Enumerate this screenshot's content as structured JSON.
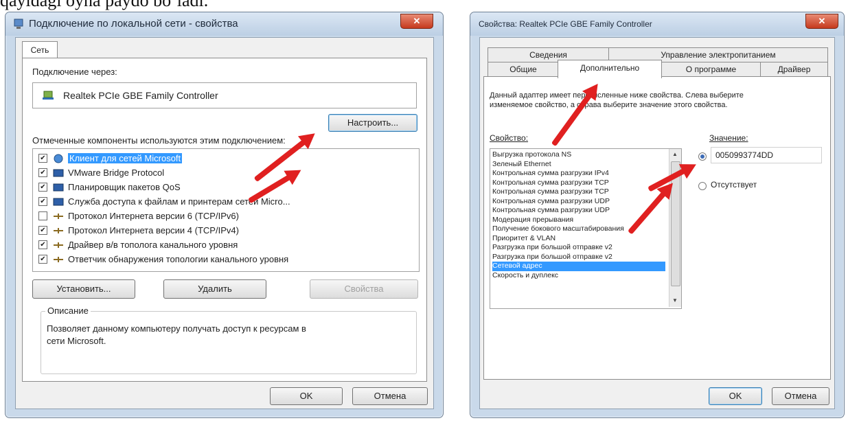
{
  "caption": "qayidagi oyna paydo bo`ladi.",
  "left_dialog": {
    "title": "Подключение по локальной сети - свойства",
    "tab": "Сеть",
    "connect_via_label": "Подключение через:",
    "adapter_name": "Realtek PCIe GBE Family Controller",
    "configure_button": "Настроить...",
    "components_label": "Отмеченные компоненты используются этим подключением:",
    "components": [
      {
        "label": "Клиент для сетей Microsoft",
        "checked": true,
        "selected": true
      },
      {
        "label": "VMware Bridge Protocol",
        "checked": true,
        "selected": false
      },
      {
        "label": "Планировщик пакетов QoS",
        "checked": true,
        "selected": false
      },
      {
        "label": "Служба доступа к файлам и принтерам сетей Micro...",
        "checked": true,
        "selected": false
      },
      {
        "label": "Протокол Интернета версии 6 (TCP/IPv6)",
        "checked": false,
        "selected": false
      },
      {
        "label": "Протокол Интернета версии 4 (TCP/IPv4)",
        "checked": true,
        "selected": false
      },
      {
        "label": "Драйвер в/в тополога канального уровня",
        "checked": true,
        "selected": false
      },
      {
        "label": "Ответчик обнаружения топологии канального уровня",
        "checked": true,
        "selected": false
      }
    ],
    "install_button": "Установить...",
    "remove_button": "Удалить",
    "properties_button": "Свойства",
    "description_label": "Описание",
    "description_text": "Позволяет данному компьютеру получать доступ к ресурсам в сети Microsoft.",
    "ok_button": "OK",
    "cancel_button": "Отмена"
  },
  "right_dialog": {
    "title": "Свойства: Realtek PCIe GBE Family Controller",
    "tabs_top": [
      "Сведения",
      "Управление электропитанием"
    ],
    "tabs_bottom": [
      "Общие",
      "Дополнительно",
      "О программе",
      "Драйвер"
    ],
    "active_tab": "Дополнительно",
    "intro": "Данный адаптер имеет перечисленные ниже свойства. Слева выберите изменяемое свойство, а справа выберите значение этого свойства.",
    "property_label": "Свойство:",
    "value_label": "Значение:",
    "properties": [
      "Выгрузка протокола NS",
      "Зеленый Ethernet",
      "Контрольная сумма разгрузки IPv4",
      "Контрольная сумма разгрузки TCP",
      "Контрольная сумма разгрузки TCP",
      "Контрольная сумма разгрузки UDP",
      "Контрольная сумма разгрузки UDP",
      "Модерация прерывания",
      "Получение бокового масштабирования",
      "Приоритет & VLAN",
      "Разгрузка при большой отправке v2",
      "Разгрузка при большой отправке v2",
      "Сетевой адрес",
      "Скорость и дуплекс"
    ],
    "selected_property": "Сетевой адрес",
    "value": "0050993774DD",
    "absent_label": "Отсутствует",
    "ok_button": "OK",
    "cancel_button": "Отмена"
  },
  "colors": {
    "arrow": "#e02020",
    "selection": "#3399ff",
    "close_button": "#c5391d"
  }
}
